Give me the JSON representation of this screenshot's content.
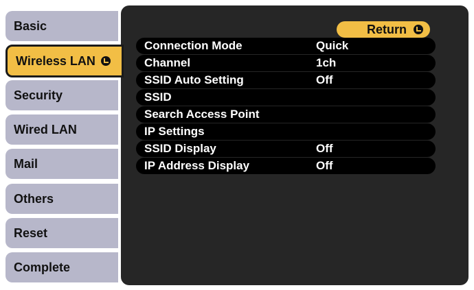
{
  "sidebar": {
    "items": [
      {
        "label": "Basic",
        "active": false
      },
      {
        "label": "Wireless LAN",
        "active": true
      },
      {
        "label": "Security",
        "active": false
      },
      {
        "label": "Wired LAN",
        "active": false
      },
      {
        "label": "Mail",
        "active": false
      },
      {
        "label": "Others",
        "active": false
      },
      {
        "label": "Reset",
        "active": false
      },
      {
        "label": "Complete",
        "active": false
      }
    ]
  },
  "panel": {
    "return_label": "Return",
    "rows": [
      {
        "label": "Connection Mode",
        "value": "Quick"
      },
      {
        "label": "Channel",
        "value": "1ch"
      },
      {
        "label": "SSID Auto Setting",
        "value": "Off"
      },
      {
        "label": "SSID",
        "value": ""
      },
      {
        "label": "Search Access Point",
        "value": ""
      },
      {
        "label": "IP Settings",
        "value": ""
      },
      {
        "label": "SSID Display",
        "value": "Off"
      },
      {
        "label": "IP Address Display",
        "value": "Off"
      }
    ]
  },
  "colors": {
    "tab_bg": "#b7b7ca",
    "active_tab_bg": "#f2be45",
    "panel_bg": "#262626",
    "row_bg": "#000000"
  },
  "icons": {
    "enter": "enter-icon"
  }
}
